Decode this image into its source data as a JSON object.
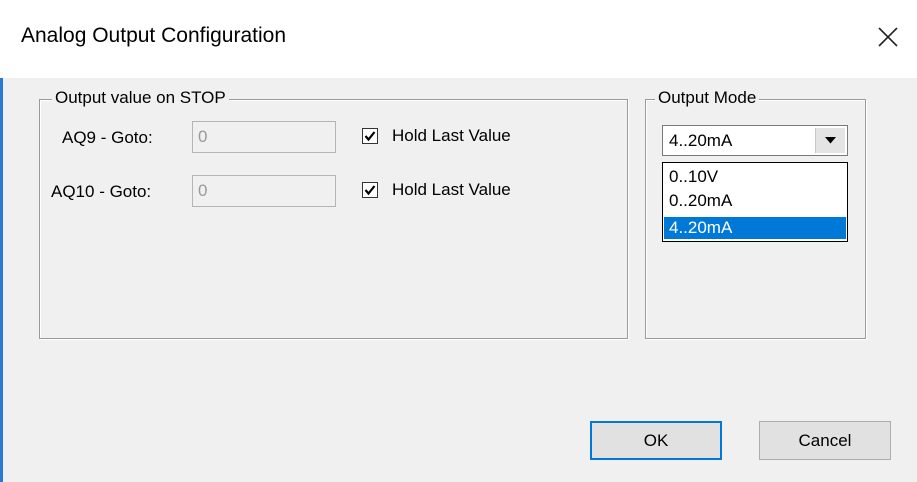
{
  "window": {
    "title": "Analog Output Configuration"
  },
  "stop_group": {
    "legend": "Output value on STOP",
    "channels": [
      {
        "label": "AQ9 - Goto:",
        "value": "0",
        "hold_label": "Hold Last Value",
        "hold_checked": true
      },
      {
        "label": "AQ10 - Goto:",
        "value": "0",
        "hold_label": "Hold Last Value",
        "hold_checked": true
      }
    ]
  },
  "mode_group": {
    "legend": "Output Mode",
    "selected": "4..20mA",
    "options": [
      "0..10V",
      "0..20mA",
      "4..20mA"
    ],
    "highlighted_index": 2
  },
  "buttons": {
    "ok_label": "OK",
    "cancel_label": "Cancel"
  },
  "colors": {
    "accent": "#0078d7",
    "window_border": "#2b79d4",
    "dialog_bg": "#f0f0f0"
  },
  "icons": {
    "close": "close-icon",
    "dropdown": "chevron-down-icon",
    "check": "checkmark-icon"
  }
}
